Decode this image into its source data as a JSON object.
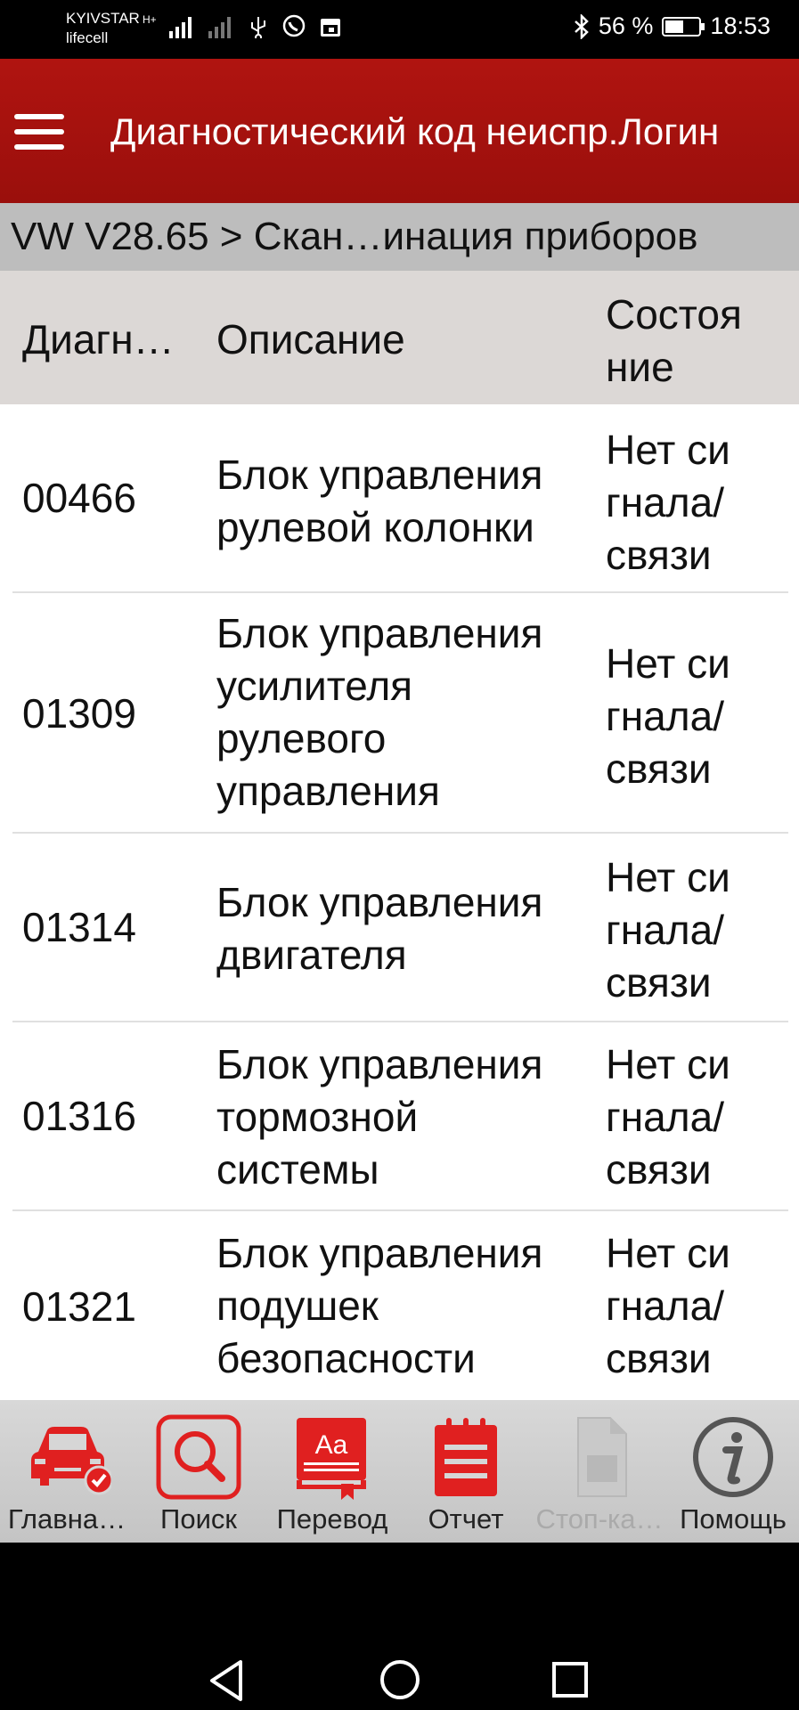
{
  "status_bar": {
    "carrier1": "KYIVSTAR",
    "carrier2": "lifecell",
    "network_type": "H+",
    "battery": "56 %",
    "battery_level": 0.56,
    "time": "18:53",
    "icons": [
      "signal-icon",
      "signal-icon",
      "usb-icon",
      "viber-icon",
      "calendar-icon",
      "bluetooth-icon",
      "battery-icon"
    ]
  },
  "app_bar": {
    "title": "Диагностический код неиспр.Логин"
  },
  "breadcrumb": "VW V28.65 > Скан…инация приборов",
  "table": {
    "headers": {
      "code": "Диагн…",
      "description": "Описание",
      "state_line1": "Состоя",
      "state_line2": "ние"
    },
    "rows": [
      {
        "code": "00466",
        "desc": [
          "Блок управления",
          "рулевой колонки"
        ],
        "state": [
          "Нет си",
          "гнала/",
          "связи"
        ]
      },
      {
        "code": "01309",
        "desc": [
          "Блок управления",
          "усилителя",
          "рулевого",
          "управления"
        ],
        "state": [
          "Нет си",
          "гнала/",
          "связи"
        ]
      },
      {
        "code": "01314",
        "desc": [
          "Блок управления",
          "двигателя"
        ],
        "state": [
          "Нет си",
          "гнала/",
          "связи"
        ]
      },
      {
        "code": "01316",
        "desc": [
          "Блок управления",
          "тормозной",
          "системы"
        ],
        "state": [
          "Нет си",
          "гнала/",
          "связи"
        ]
      },
      {
        "code": "01321",
        "desc": [
          "Блок управления",
          "подушек",
          "безопасности"
        ],
        "state": [
          "Нет си",
          "гнала/",
          "связи"
        ]
      }
    ]
  },
  "bottom_nav": [
    {
      "label": "Главна…",
      "icon": "car-check-icon",
      "enabled": true
    },
    {
      "label": "Поиск",
      "icon": "search-icon",
      "enabled": true
    },
    {
      "label": "Перевод",
      "icon": "translate-book-icon",
      "enabled": true
    },
    {
      "label": "Отчет",
      "icon": "report-notepad-icon",
      "enabled": true
    },
    {
      "label": "Стоп-ка…",
      "icon": "document-icon",
      "enabled": false
    },
    {
      "label": "Помощь",
      "icon": "info-icon",
      "enabled": true
    }
  ],
  "colors": {
    "accent": "#e02020",
    "app_bar": "#a8120e"
  }
}
